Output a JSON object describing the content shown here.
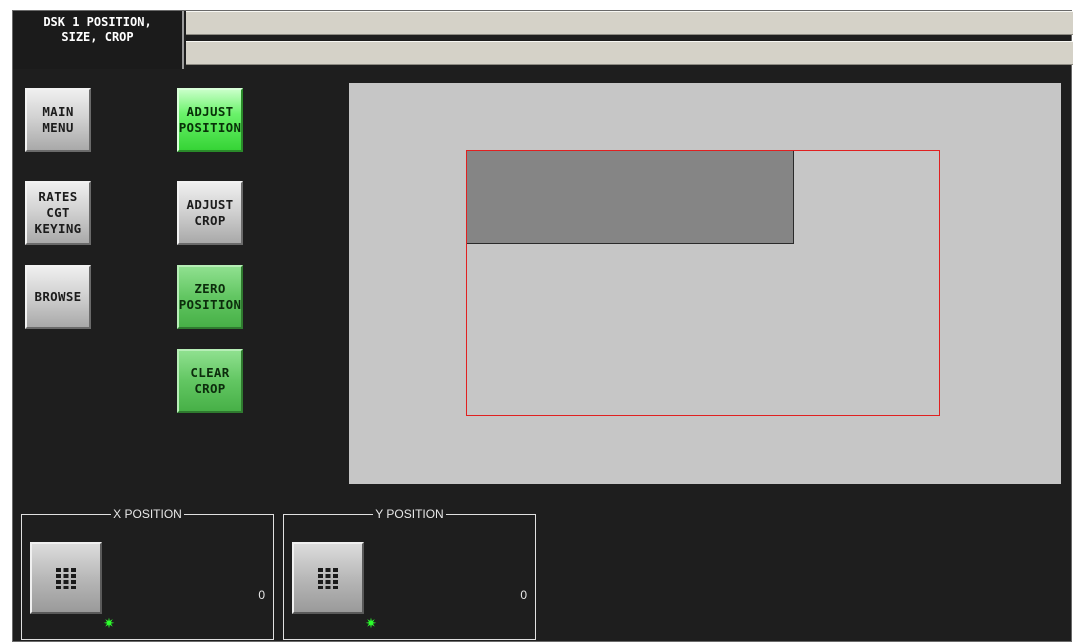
{
  "tab": {
    "title": "DSK 1 POSITION,\nSIZE, CROP"
  },
  "buttons": {
    "main_menu": "MAIN\nMENU",
    "rates_cgt_keying": "RATES\nCGT\nKEYING",
    "browse": "BROWSE",
    "adjust_position": "ADJUST\nPOSITION",
    "adjust_crop": "ADJUST\nCROP",
    "zero_position": "ZERO\nPOSITION",
    "clear_crop": "CLEAR\nCROP"
  },
  "controls": {
    "x_position": {
      "label": "X POSITION",
      "value": "0",
      "keypad_icon": "keypad-grid-icon",
      "indicator_icon": "green-star-led"
    },
    "y_position": {
      "label": "Y POSITION",
      "value": "0",
      "keypad_icon": "keypad-grid-icon",
      "indicator_icon": "green-star-led"
    }
  },
  "colors": {
    "background": "#1e1e1e",
    "preview_background": "#c6c6c6",
    "frame_outline": "#e02020",
    "dsk_rect": "#858585",
    "active_green": "#6af26a",
    "green": "#62c662",
    "led_green": "#2cff2c"
  }
}
